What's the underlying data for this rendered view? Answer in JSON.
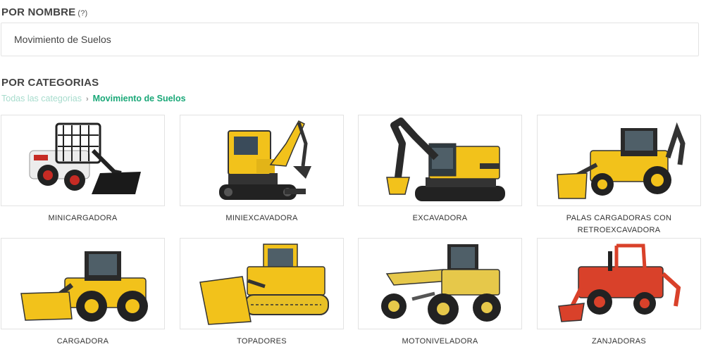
{
  "by_name": {
    "title": "POR NOMBRE",
    "help": "(?)",
    "input_value": "Movimiento de Suelos"
  },
  "by_category": {
    "title": "POR CATEGORIAS",
    "breadcrumb": {
      "root": "Todas las categorias",
      "separator": "›",
      "current": "Movimiento de Suelos"
    }
  },
  "categories": [
    {
      "label": "MINICARGADORA",
      "icon": "skid-steer-loader-image"
    },
    {
      "label": "MINIEXCAVADORA",
      "icon": "mini-excavator-image"
    },
    {
      "label": "EXCAVADORA",
      "icon": "excavator-image"
    },
    {
      "label": "PALAS CARGADORAS CON RETROEXCAVADORA",
      "icon": "backhoe-loader-image"
    },
    {
      "label": "CARGADORA",
      "icon": "wheel-loader-image"
    },
    {
      "label": "TOPADORES",
      "icon": "bulldozer-image"
    },
    {
      "label": "MOTONIVELADORA",
      "icon": "motor-grader-image"
    },
    {
      "label": "ZANJADORAS",
      "icon": "trencher-image"
    }
  ],
  "colors": {
    "machine_yellow": "#f2c21b",
    "machine_white": "#ececec",
    "machine_red": "#d9412a",
    "breadcrumb_root": "#a7dccd",
    "breadcrumb_current": "#1aa878"
  }
}
